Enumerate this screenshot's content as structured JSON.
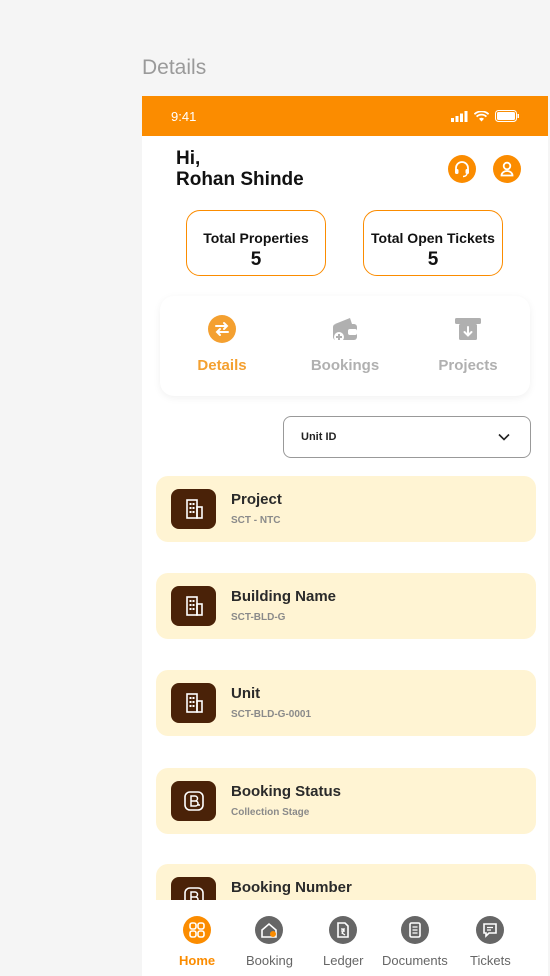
{
  "frame_title": "Details",
  "status_bar": {
    "time": "9:41"
  },
  "header": {
    "greeting": "Hi,",
    "user_name": "Rohan Shinde"
  },
  "stats": [
    {
      "label": "Total Properties",
      "value": "5"
    },
    {
      "label": "Total Open Tickets",
      "value": "5"
    }
  ],
  "tabs": [
    {
      "label": "Details",
      "icon": "transfer-icon",
      "active": true
    },
    {
      "label": "Bookings",
      "icon": "wallet-icon",
      "active": false
    },
    {
      "label": "Projects",
      "icon": "download-box-icon",
      "active": false
    }
  ],
  "dropdown": {
    "selected": "Unit ID"
  },
  "cards": [
    {
      "title": "Project",
      "subtitle": "SCT - NTC",
      "icon": "building-icon"
    },
    {
      "title": "Building Name",
      "subtitle": "SCT-BLD-G",
      "icon": "building-icon"
    },
    {
      "title": "Unit",
      "subtitle": "SCT-BLD-G-0001",
      "icon": "building-icon"
    },
    {
      "title": "Booking Status",
      "subtitle": "Collection Stage",
      "icon": "booking-b-icon"
    },
    {
      "title": "Booking Number",
      "subtitle": "",
      "icon": "booking-b-icon"
    }
  ],
  "bottom_nav": [
    {
      "label": "Home",
      "icon": "home-grid-icon",
      "active": true
    },
    {
      "label": "Booking",
      "icon": "booking-home-icon",
      "active": false
    },
    {
      "label": "Ledger",
      "icon": "rupee-doc-icon",
      "active": false
    },
    {
      "label": "Documents",
      "icon": "document-icon",
      "active": false
    },
    {
      "label": "Tickets",
      "icon": "chat-icon",
      "active": false
    }
  ],
  "colors": {
    "accent": "#fb8c00",
    "card_bg": "#fff4d3",
    "card_icon_bg": "#4a2208",
    "tab_active": "#f4a030",
    "muted": "#b0b0b0"
  }
}
